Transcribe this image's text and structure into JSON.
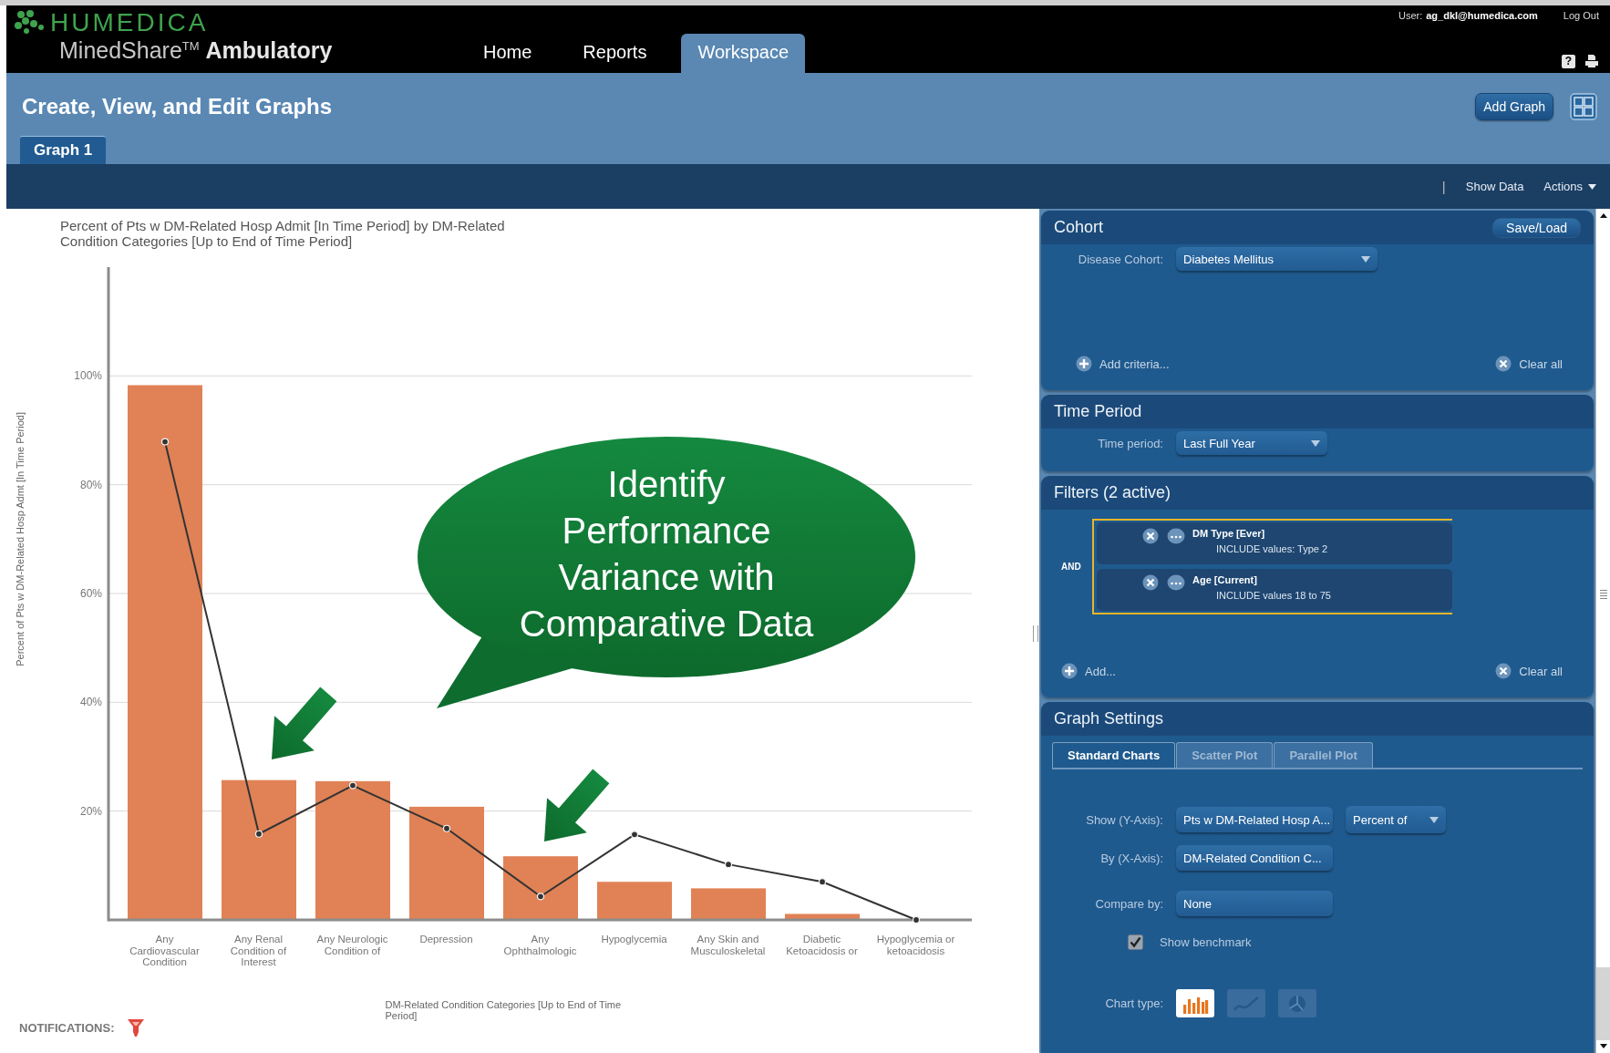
{
  "header": {
    "logo": "HUMEDICA",
    "product": "MinedShare$^{TM}$ **Ambulatory**",
    "nav": [
      {
        "label": "Home",
        "selected": false
      },
      {
        "label": "Reports",
        "selected": false
      },
      {
        "label": "Workspace",
        "selected": true
      }
    ],
    "user_label": "User:",
    "user": "ag_dkl@humedica.com",
    "logout": "Log Out",
    "help": "?"
  },
  "page": {
    "title": "Create, View, and Edit Graphs",
    "add_button": "Add Graph",
    "tabs": [
      {
        "label": "Graph 1",
        "selected": true
      }
    ]
  },
  "toolbar": {
    "separator": "|",
    "items": [
      {
        "kind": "link",
        "label": "Show Data"
      },
      {
        "kind": "menu",
        "label": "Actions"
      }
    ]
  },
  "chart": {
    "chart_data": {
      "type": "bar",
      "title": "Percent of Pts w DM-Related Hosp Admit [In Time Period] by DM-Related Condition Categories [Up to End of Time Period]",
      "xlabel": "DM-Related Condition Categories [Up to End of Time Period]",
      "ylabel": "Percent of Pts w DM-Related Hosp Admt [In Time Period]",
      "categories": [
        "Any Cardiovascular Condition",
        "Any Renal Condition of Interest",
        "Any Neurologic Condition of",
        "Depression",
        "Any Ophthalmologic",
        "Hypoglycemia",
        "Any Skin and Musculoskeletal",
        "Diabetic Ketoacidosis or",
        "Hypoglycemia or ketoacidosis"
      ],
      "series": [
        {
          "type": "bar",
          "color": "#e08256",
          "values": [
            98.3,
            25.7,
            25.5,
            20.8,
            11.7,
            7.0,
            5.8,
            1.1,
            0
          ]
        },
        {
          "type": "line",
          "color": "#333333",
          "marker": "circle",
          "values": [
            87.9,
            15.8,
            24.7,
            16.8,
            4.3,
            15.7,
            10.2,
            7.0,
            0
          ]
        }
      ],
      "ylim": [
        0,
        120
      ],
      "grid": true,
      "yticks": [
        {
          "value": 20,
          "label": "20%"
        },
        {
          "value": 40,
          "label": "40%"
        },
        {
          "value": 60,
          "label": "60%"
        },
        {
          "value": 80,
          "label": "80%"
        },
        {
          "value": 100,
          "label": "100%"
        }
      ]
    },
    "callout": "Identify Performance Variance with Comparative Data",
    "notifications_label": "NOTIFICATIONS:"
  },
  "panels": [
    {
      "kind": "cohort",
      "title": "Cohort",
      "button": "Save/Load",
      "rows": [
        {
          "kind": "controls",
          "label": "Disease Cohort:",
          "controls": [
            {
              "kind": "dropdown",
              "value": "Diabetes Mellitus"
            }
          ]
        }
      ],
      "footer": {
        "add": "Add criteria...",
        "clear": "Clear all"
      }
    },
    {
      "kind": "time",
      "title": "Time Period",
      "rows": [
        {
          "kind": "controls",
          "label": "Time period:",
          "controls": [
            {
              "kind": "dropdown",
              "value": "Last Full Year"
            }
          ]
        }
      ]
    },
    {
      "kind": "filters",
      "title": "Filters (2 active)",
      "filters": {
        "connector": "AND",
        "items": [
          {
            "name": "DM Type [Ever]",
            "detail": "INCLUDE values: Type 2"
          },
          {
            "name": "Age [Current]",
            "detail": "INCLUDE values 18 to 75"
          }
        ]
      },
      "footer": {
        "add": "Add...",
        "clear": "Clear all"
      }
    },
    {
      "kind": "settings",
      "title": "Graph Settings",
      "tabs": [
        {
          "label": "Standard Charts",
          "selected": true
        },
        {
          "label": "Scatter Plot",
          "selected": false
        },
        {
          "label": "Parallel Plot",
          "selected": false
        }
      ],
      "rows": [
        {
          "kind": "controls",
          "label": "Show (Y-Axis):",
          "controls": [
            {
              "kind": "button",
              "value": "Pts w DM-Related Hosp A..."
            },
            {
              "kind": "dropdown",
              "value": "Percent of"
            }
          ]
        },
        {
          "kind": "controls",
          "label": "By (X-Axis):",
          "controls": [
            {
              "kind": "button",
              "value": "DM-Related Condition C..."
            }
          ]
        },
        {
          "kind": "controls",
          "label": "Compare by:",
          "controls": [
            {
              "kind": "button",
              "value": "None"
            }
          ]
        },
        {
          "kind": "checkbox",
          "label": "Show benchmark",
          "checked": true
        },
        {
          "kind": "chart_types",
          "label": "Chart type:",
          "options": [
            {
              "kind": "bar",
              "selected": true
            },
            {
              "kind": "line",
              "selected": false
            },
            {
              "kind": "pie",
              "selected": false
            }
          ]
        }
      ]
    }
  ]
}
